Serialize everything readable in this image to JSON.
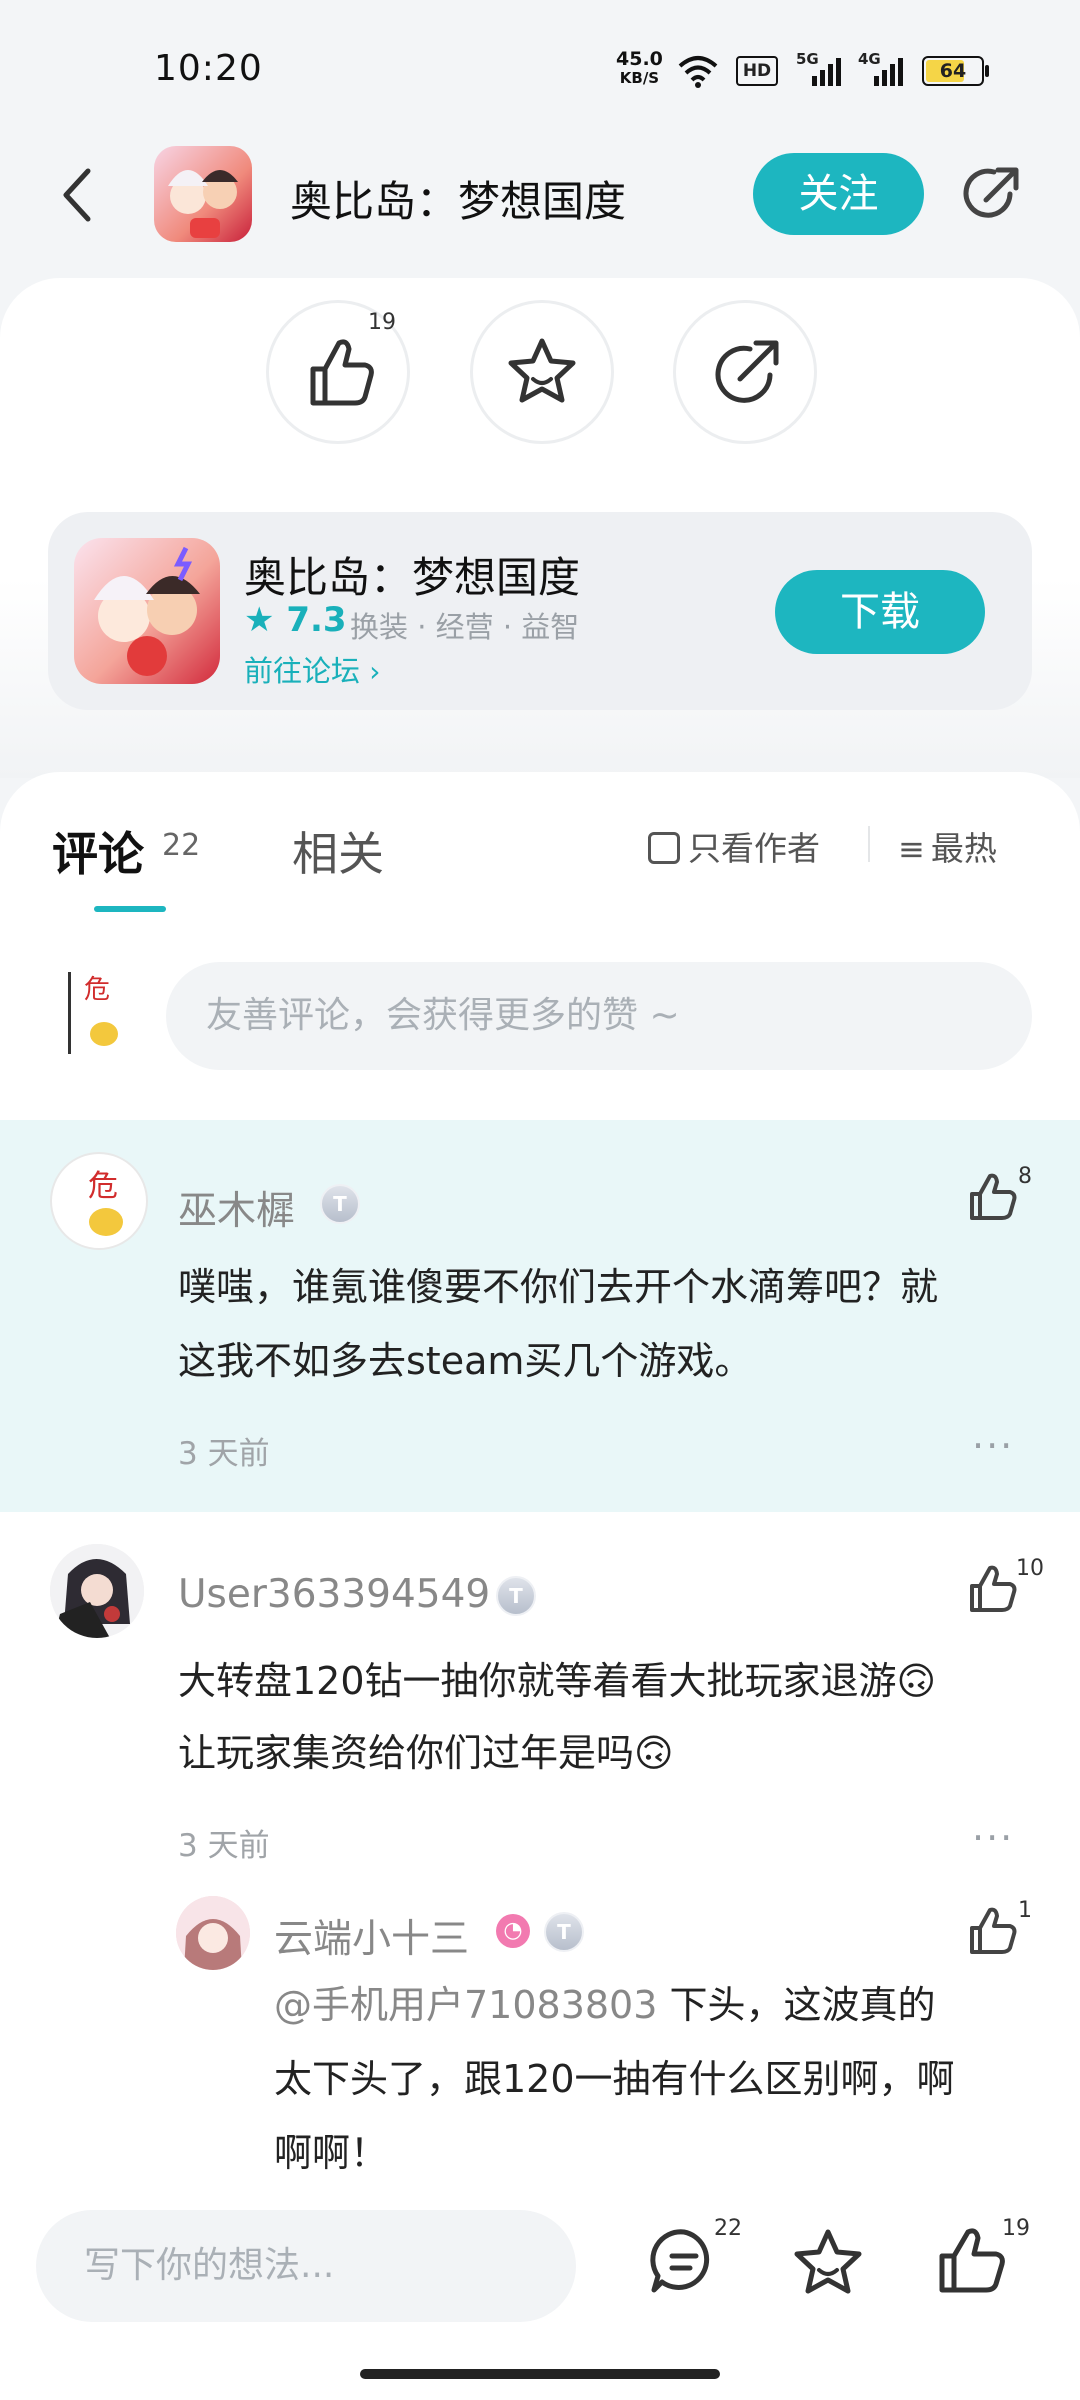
{
  "status_bar": {
    "time": "10:20",
    "net_speed": "45.0",
    "net_speed_unit": "KB/S",
    "hd_label": "HD",
    "sim1_label": "5G",
    "sim2_label": "4G",
    "battery": "64"
  },
  "header": {
    "app_title": "奥比岛：梦想国度",
    "follow_label": "关注"
  },
  "actions": {
    "like_count": "19"
  },
  "game_card": {
    "name": "奥比岛：梦想国度",
    "rating": "7.3",
    "tags": "换装 · 经营 · 益智",
    "forum_link": "前往论坛",
    "download_label": "下载"
  },
  "tabs": {
    "comments_label": "评论",
    "comments_count": "22",
    "related_label": "相关",
    "author_only": "只看作者",
    "sort_label": "最热"
  },
  "comment_input": {
    "placeholder": "友善评论，会获得更多的赞 ~"
  },
  "comments": [
    {
      "user": "巫木樨",
      "badge": "T",
      "text_line1": "噗嗤，谁氪谁傻要不你们去开个水滴筹吧？就",
      "text_line2": "这我不如多去steam买几个游戏。",
      "time": "3 天前",
      "likes": "8"
    },
    {
      "user": "User363394549",
      "badge": "T",
      "text_line1": "大转盘120钻一抽你就等着看大批玩家退游🙃",
      "text_line2": "让玩家集资给你们过年是吗🙃",
      "time": "3 天前",
      "likes": "10"
    }
  ],
  "reply": {
    "user": "云端小十三",
    "badge": "T",
    "text_mention": "@手机用户71083803",
    "text_line1": " 下头，这波真的",
    "text_line2": "太下头了，跟120一抽有什么区别啊，啊",
    "text_line3": "啊啊！",
    "likes": "1"
  },
  "bottom_bar": {
    "placeholder": "写下你的想法...",
    "comment_count": "22",
    "like_count": "19"
  },
  "colors": {
    "accent": "#1db6c0",
    "highlight_bg": "#e9f7f8"
  }
}
